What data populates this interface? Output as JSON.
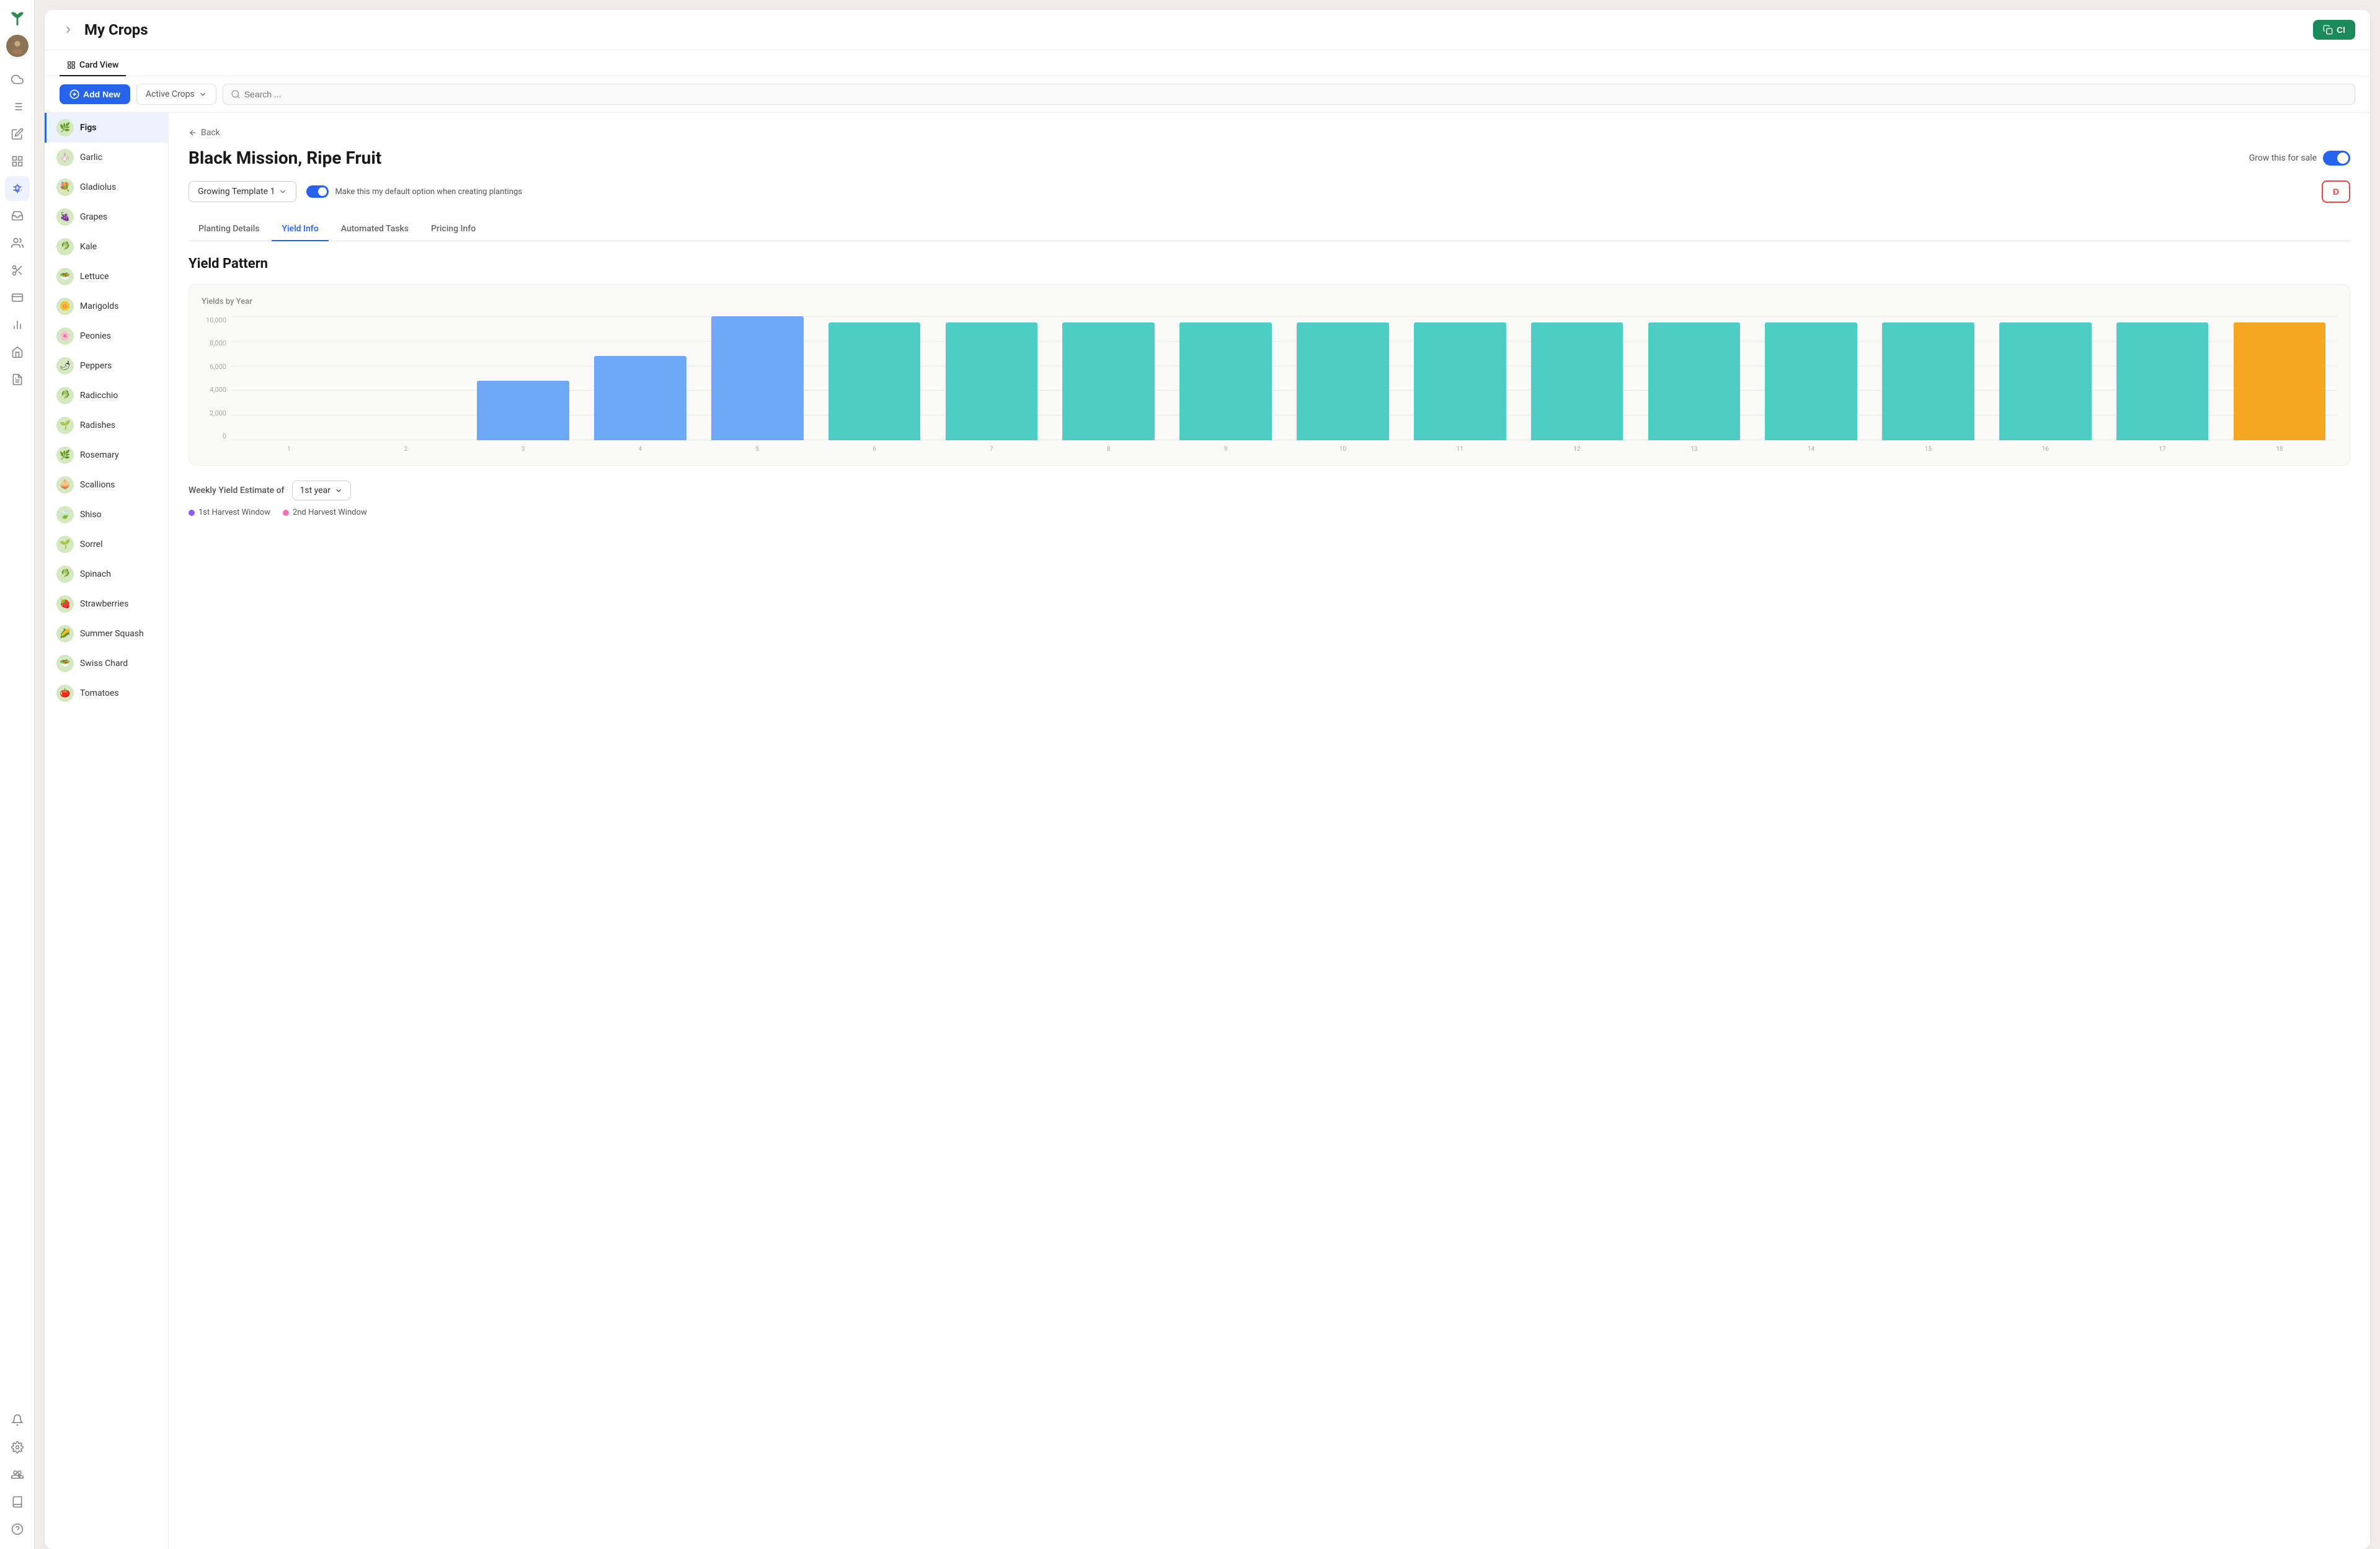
{
  "app": {
    "logo_icon": "leaf-icon",
    "title": "My Crops",
    "clone_button": "Cl..."
  },
  "nav": {
    "items": [
      {
        "name": "cloud-icon",
        "label": "Cloud",
        "active": false
      },
      {
        "name": "list-icon",
        "label": "List",
        "active": false
      },
      {
        "name": "edit-icon",
        "label": "Edit",
        "active": false
      },
      {
        "name": "grid-icon",
        "label": "Grid",
        "active": false
      },
      {
        "name": "crop-icon",
        "label": "Crop",
        "active": true
      },
      {
        "name": "inbox-icon",
        "label": "Inbox",
        "active": false
      },
      {
        "name": "people-icon",
        "label": "People",
        "active": false
      },
      {
        "name": "scissors-icon",
        "label": "Scissors",
        "active": false
      },
      {
        "name": "card-icon",
        "label": "Card",
        "active": false
      },
      {
        "name": "chart-icon",
        "label": "Chart",
        "active": false
      },
      {
        "name": "building-icon",
        "label": "Building",
        "active": false
      },
      {
        "name": "report-icon",
        "label": "Report",
        "active": false
      },
      {
        "name": "bell-icon",
        "label": "Bell",
        "active": false
      },
      {
        "name": "settings-icon",
        "label": "Settings",
        "active": false
      },
      {
        "name": "team-icon",
        "label": "Team",
        "active": false
      },
      {
        "name": "book-icon",
        "label": "Book",
        "active": false
      },
      {
        "name": "help-icon",
        "label": "Help",
        "active": false
      }
    ]
  },
  "header": {
    "title": "My Crops",
    "clone_label": "Cl"
  },
  "view_tabs": [
    {
      "label": "Card View",
      "active": true
    }
  ],
  "toolbar": {
    "search_placeholder": "Search ...",
    "add_new_label": "Add New",
    "filter_label": "Active Crops",
    "filter_arrow": "▾"
  },
  "crops": [
    {
      "name": "Figs",
      "emoji": "🌿",
      "active": true
    },
    {
      "name": "Garlic",
      "emoji": "🧄"
    },
    {
      "name": "Gladiolus",
      "emoji": "💐"
    },
    {
      "name": "Grapes",
      "emoji": "🍇"
    },
    {
      "name": "Kale",
      "emoji": "🥬"
    },
    {
      "name": "Lettuce",
      "emoji": "🥗"
    },
    {
      "name": "Marigolds",
      "emoji": "🌼"
    },
    {
      "name": "Peonies",
      "emoji": "🌸"
    },
    {
      "name": "Peppers",
      "emoji": "🌶"
    },
    {
      "name": "Radicchio",
      "emoji": "🥬"
    },
    {
      "name": "Radishes",
      "emoji": "🌱"
    },
    {
      "name": "Rosemary",
      "emoji": "🌿"
    },
    {
      "name": "Scallions",
      "emoji": "🧅"
    },
    {
      "name": "Shiso",
      "emoji": "🍃"
    },
    {
      "name": "Sorrel",
      "emoji": "🌱"
    },
    {
      "name": "Spinach",
      "emoji": "🥬"
    },
    {
      "name": "Strawberries",
      "emoji": "🍓"
    },
    {
      "name": "Summer Squash",
      "emoji": "🌽"
    },
    {
      "name": "Swiss Chard",
      "emoji": "🥗"
    },
    {
      "name": "Tomatoes",
      "emoji": "🍅"
    }
  ],
  "detail": {
    "back_label": "Back",
    "crop_name": "Black Mission, Ripe Fruit",
    "grow_for_sale_label": "Grow this for sale",
    "template_label": "Growing Template 1",
    "default_toggle_label": "Make this my default option when creating plantings",
    "delete_label": "D",
    "tabs": [
      {
        "label": "Planting Details",
        "active": false
      },
      {
        "label": "Yield Info",
        "active": true
      },
      {
        "label": "Automated Tasks",
        "active": false
      },
      {
        "label": "Pricing Info",
        "active": false
      }
    ],
    "yield_pattern_title": "Yield Pattern",
    "chart": {
      "y_label": "Yields by Year",
      "y_axis": [
        "10,000",
        "8,000",
        "6,000",
        "4,000",
        "2,000",
        "0"
      ],
      "bars": [
        {
          "x": "1",
          "height_pct": 0,
          "type": "none"
        },
        {
          "x": "2",
          "height_pct": 0,
          "type": "none"
        },
        {
          "x": "3",
          "height_pct": 48,
          "type": "blue"
        },
        {
          "x": "4",
          "height_pct": 68,
          "type": "blue"
        },
        {
          "x": "5",
          "height_pct": 100,
          "type": "blue"
        },
        {
          "x": "6",
          "height_pct": 95,
          "type": "teal"
        },
        {
          "x": "7",
          "height_pct": 95,
          "type": "teal"
        },
        {
          "x": "8",
          "height_pct": 95,
          "type": "teal"
        },
        {
          "x": "9",
          "height_pct": 95,
          "type": "teal"
        },
        {
          "x": "10",
          "height_pct": 95,
          "type": "teal"
        },
        {
          "x": "11",
          "height_pct": 95,
          "type": "teal"
        },
        {
          "x": "12",
          "height_pct": 95,
          "type": "teal"
        },
        {
          "x": "13",
          "height_pct": 95,
          "type": "teal"
        },
        {
          "x": "14",
          "height_pct": 95,
          "type": "teal"
        },
        {
          "x": "15",
          "height_pct": 95,
          "type": "teal"
        },
        {
          "x": "16",
          "height_pct": 95,
          "type": "teal"
        },
        {
          "x": "17",
          "height_pct": 95,
          "type": "teal"
        },
        {
          "x": "18",
          "height_pct": 95,
          "type": "orange"
        }
      ]
    },
    "weekly_yield_label": "Weekly Yield Estimate of",
    "year_select_label": "1st year",
    "legend": [
      {
        "label": "1st Harvest Window",
        "color": "purple"
      },
      {
        "label": "2nd Harvest Window",
        "color": "pink"
      }
    ]
  }
}
